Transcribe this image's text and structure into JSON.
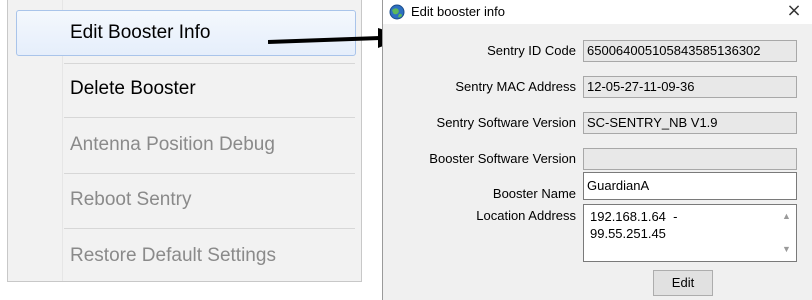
{
  "context_menu": {
    "items": [
      {
        "label": "Edit Booster Info",
        "state": "highlighted"
      },
      {
        "label": "Delete Booster",
        "state": "enabled"
      },
      {
        "label": "Antenna Position Debug",
        "state": "disabled"
      },
      {
        "label": "Reboot Sentry",
        "state": "disabled"
      },
      {
        "label": "Restore Default Settings",
        "state": "disabled"
      }
    ]
  },
  "dialog": {
    "title": "Edit booster info",
    "close_glyph": "×",
    "fields": {
      "sentry_id": {
        "label": "Sentry ID Code",
        "value": "650064005105843585136302"
      },
      "sentry_mac": {
        "label": "Sentry MAC Address",
        "value": "12-05-27-11-09-36"
      },
      "sentry_sw": {
        "label": "Sentry Software Version",
        "value": "SC-SENTRY_NB V1.9"
      },
      "booster_sw": {
        "label": "Booster Software Version",
        "value": ""
      },
      "booster_name": {
        "label": "Booster Name",
        "value": "GuardianA"
      },
      "location": {
        "label": "Location Address",
        "line1": "192.168.1.64  -",
        "line2": "99.55.251.45"
      }
    },
    "edit_button": "Edit"
  },
  "colors": {
    "highlight": "#e5eefb",
    "highlight_border": "#a9c4ea",
    "disabled_text": "#8a8a8a",
    "dialog_bg": "#f0f0f0"
  }
}
